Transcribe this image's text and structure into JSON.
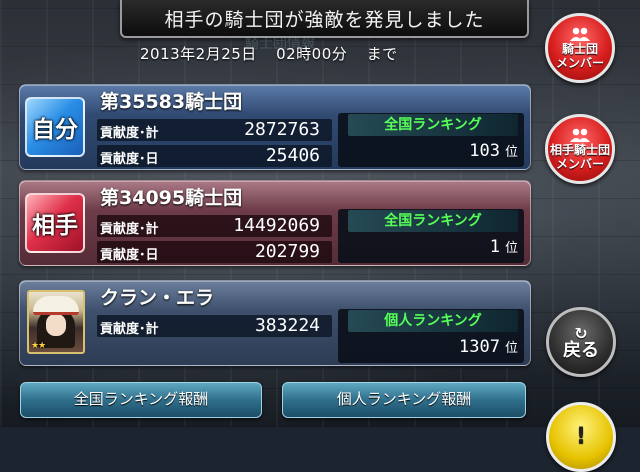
{
  "header": {
    "banner_text": "相手の騎士団が強敵を発見しました",
    "subtitle_ghost": "騎士団情報",
    "deadline_date": "2013年2月25日",
    "deadline_time": "02時00分",
    "deadline_suffix": "まで"
  },
  "self": {
    "badge": "自分",
    "name": "第35583騎士団",
    "total_label": "貢献度･計",
    "total_value": "2872763",
    "day_label": "貢献度･日",
    "day_value": "25406",
    "rank_title": "全国ランキング",
    "rank_value": "103",
    "rank_unit": "位"
  },
  "rival": {
    "badge": "相手",
    "name": "第34095騎士団",
    "total_label": "貢献度･計",
    "total_value": "14492069",
    "day_label": "貢献度･日",
    "day_value": "202799",
    "rank_title": "全国ランキング",
    "rank_value": "1",
    "rank_unit": "位"
  },
  "personal": {
    "name": "クラン・エラ",
    "total_label": "貢献度･計",
    "total_value": "383224",
    "rank_title": "個人ランキング",
    "rank_value": "1307",
    "rank_unit": "位",
    "stars": "★★"
  },
  "buttons": {
    "national_reward": "全国ランキング報酬",
    "personal_reward": "個人ランキング報酬",
    "members_line1": "騎士団",
    "members_line2": "メンバー",
    "rival_members_line1": "相手騎士団",
    "rival_members_line2": "メンバー",
    "back": "戻る"
  },
  "colors": {
    "rank_title_green": "#56ff56",
    "self_badge": "#2a8ee6",
    "rival_badge": "#e0304a",
    "round_red": "#d81e1e"
  },
  "icons": {
    "members": "people-icon",
    "back": "return-arrow-icon"
  }
}
